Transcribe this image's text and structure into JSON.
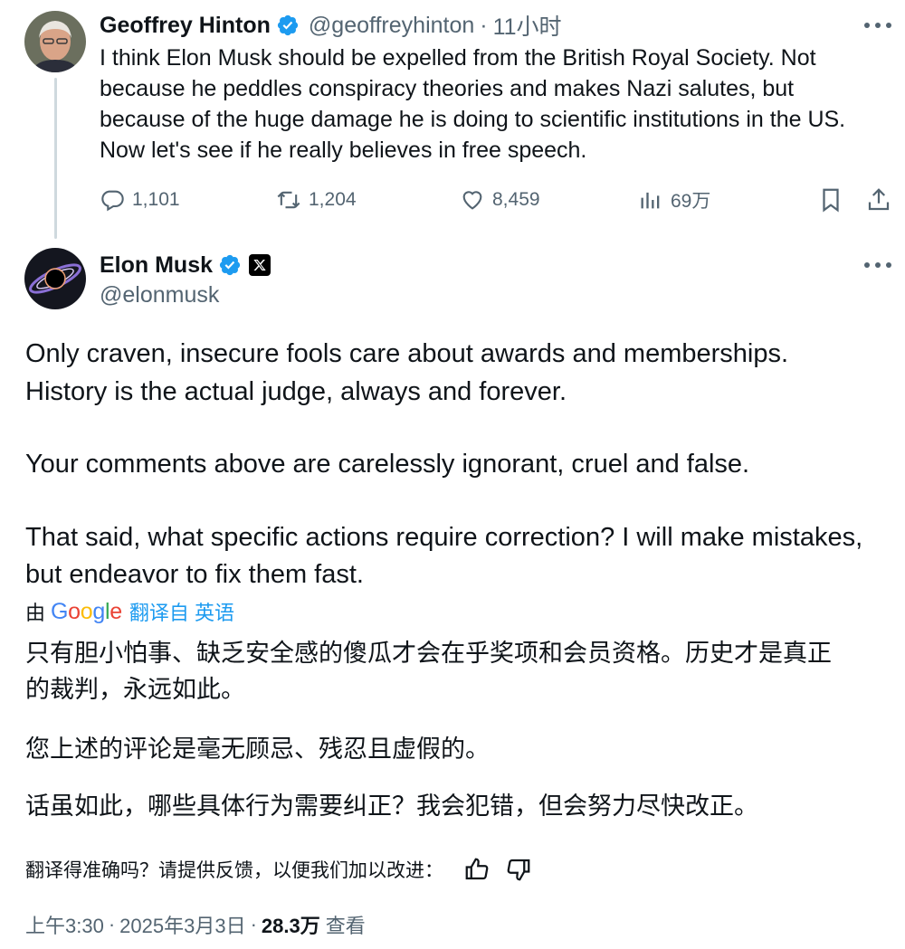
{
  "parent_tweet": {
    "author_name": "Geoffrey Hinton",
    "handle": "@geoffreyhinton",
    "dot": "·",
    "time": "11小时",
    "text_lines": [
      "I think Elon Musk should be expelled from the British Royal Society. Not",
      "because he peddles conspiracy theories and makes Nazi salutes, but",
      "because of the huge damage he is doing to scientific institutions in the US.",
      "Now let's see if he really believes in free speech."
    ],
    "stats": {
      "replies": "1,101",
      "retweets": "1,204",
      "likes": "8,459",
      "views": "69万"
    },
    "icons": [
      "verified-badge-icon",
      "more-icon",
      "reply-icon",
      "retweet-icon",
      "like-icon",
      "views-icon",
      "bookmark-icon",
      "share-icon"
    ]
  },
  "main_tweet": {
    "author_name": "Elon Musk",
    "handle": "@elonmusk",
    "text_lines": [
      "Only craven, insecure fools care about awards and memberships.",
      "History is the actual judge, always and forever.",
      "Your comments above are carelessly ignorant, cruel and false.",
      "That said, what specific actions require correction? I will make mistakes,",
      "but endeavor to fix them fast."
    ],
    "translation": {
      "by_prefix": "由",
      "provider": "Google",
      "link_text": "翻译自 英语",
      "zh_lines": [
        "只有胆小怕事、缺乏安全感的傻瓜才会在乎奖项和会员资格。历史才是真正",
        "的裁判，永远如此。",
        "您上述的评论是毫无顾忌、残忍且虚假的。",
        "话虽如此，哪些具体行为需要纠正？我会犯错，但会努力尽快改正。"
      ],
      "feedback_prompt": "翻译得准确吗？请提供反馈，以便我们加以改进："
    },
    "meta": {
      "time": "上午3:30",
      "dot1": "·",
      "date": "2025年3月3日",
      "dot2": "·",
      "views_count": "28.3万",
      "views_label": "查看"
    },
    "icons": [
      "verified-badge-icon",
      "x-affiliation-icon",
      "more-icon",
      "thumbs-up-icon",
      "thumbs-down-icon"
    ]
  },
  "colors": {
    "text": "#0f1419",
    "secondary": "#536471",
    "link": "#1d9bf0",
    "verified": "#1d9bf0",
    "thread_line": "#cfd9de"
  }
}
